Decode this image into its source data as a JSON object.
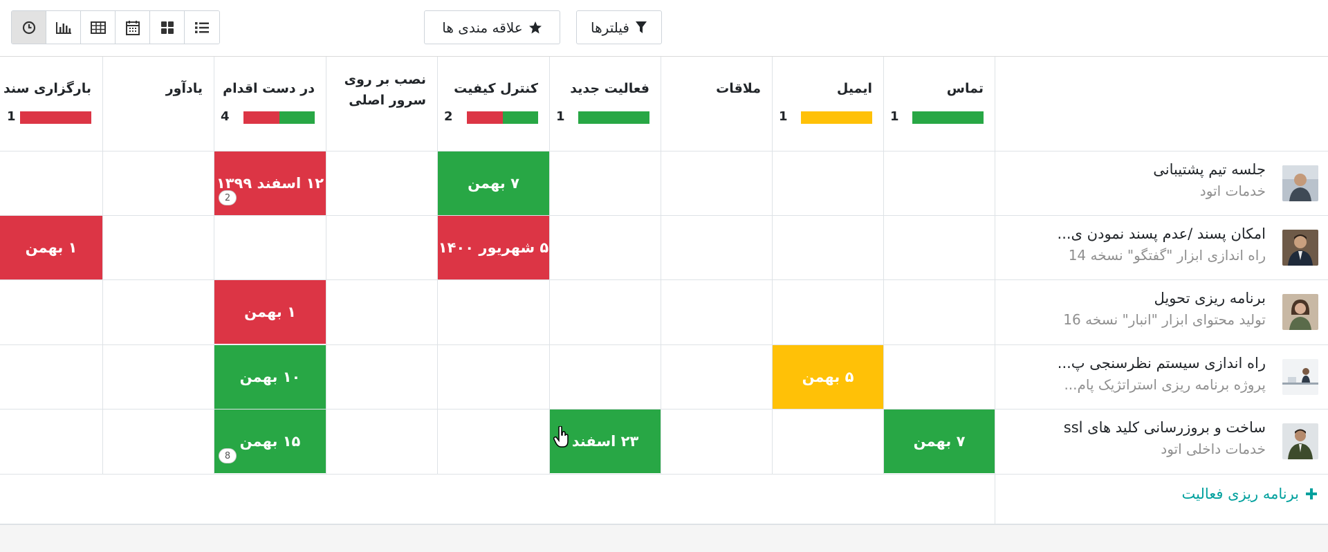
{
  "toolbar": {
    "filters_label": "فیلترها",
    "favorites_label": "علاقه مندی ها",
    "views": [
      "activity-view",
      "chart-view",
      "table-view",
      "calendar-view",
      "kanban-view",
      "list-view"
    ]
  },
  "columns": [
    {
      "title": "تماس",
      "count": "1",
      "colors": [
        "#28a745"
      ]
    },
    {
      "title": "ایمیل",
      "count": "1",
      "colors": [
        "#ffc107"
      ]
    },
    {
      "title": "ملاقات",
      "count": "",
      "colors": []
    },
    {
      "title": "فعالیت جدید",
      "count": "1",
      "colors": [
        "#28a745"
      ]
    },
    {
      "title": "کنترل کیفیت",
      "count": "2",
      "colors": [
        "#28a745",
        "#dc3545"
      ]
    },
    {
      "title_line1": "نصب بر روی",
      "title_line2": "سرور اصلی",
      "count": "",
      "colors": []
    },
    {
      "title": "در دست اقدام",
      "count": "4",
      "colors": [
        "#28a745",
        "#dc3545"
      ]
    },
    {
      "title": "یادآور",
      "count": "",
      "colors": []
    },
    {
      "title": "بارگزاری سند",
      "count": "1",
      "colors": [
        "#dc3545"
      ]
    }
  ],
  "records": [
    {
      "title": "جلسه تیم پشتیبانی",
      "subtitle": "خدمات اتود"
    },
    {
      "title": "امکان پسند /عدم پسند نمودن ی...",
      "subtitle": "راه اندازی ابزار \"گفتگو\" نسخه 14"
    },
    {
      "title": "برنامه ریزی تحویل",
      "subtitle": "تولید محتوای ابزار \"انبار\" نسخه 16"
    },
    {
      "title": "راه اندازی سیستم نظرسنجی پ...",
      "subtitle": "پروژه برنامه ریزی استراتژیک پام..."
    },
    {
      "title": "ساخت و بروزرسانی کلید های ssl",
      "subtitle": "خدمات داخلی اتود"
    }
  ],
  "cells": [
    {
      "label": "۱۲ اسفند ۱۳۹۹",
      "status": "overdue",
      "color": "#dc3545",
      "badge": "2"
    },
    {
      "label": "۷ بهمن",
      "status": "planned",
      "color": "#28a745"
    },
    {
      "label": "۱ بهمن",
      "status": "overdue",
      "color": "#dc3545"
    },
    {
      "label": "۵ شهریور ۱۴۰۰",
      "status": "overdue",
      "color": "#dc3545"
    },
    {
      "label": "۱ بهمن",
      "status": "overdue",
      "color": "#dc3545"
    },
    {
      "label": "۱۰ بهمن",
      "status": "planned",
      "color": "#28a745"
    },
    {
      "label": "۵ بهمن",
      "status": "today",
      "color": "#ffc107"
    },
    {
      "label": "۱۵ بهمن",
      "status": "planned",
      "color": "#28a745",
      "badge": "8"
    },
    {
      "label": "۲۳ اسفند",
      "status": "planned",
      "color": "#28a745"
    },
    {
      "label": "۷ بهمن",
      "status": "planned",
      "color": "#28a745"
    }
  ],
  "footer": {
    "add_label": "برنامه ریزی فعالیت"
  },
  "colors": {
    "planned": "#28a745",
    "overdue": "#dc3545",
    "today": "#ffc107",
    "link": "#00a09d"
  }
}
